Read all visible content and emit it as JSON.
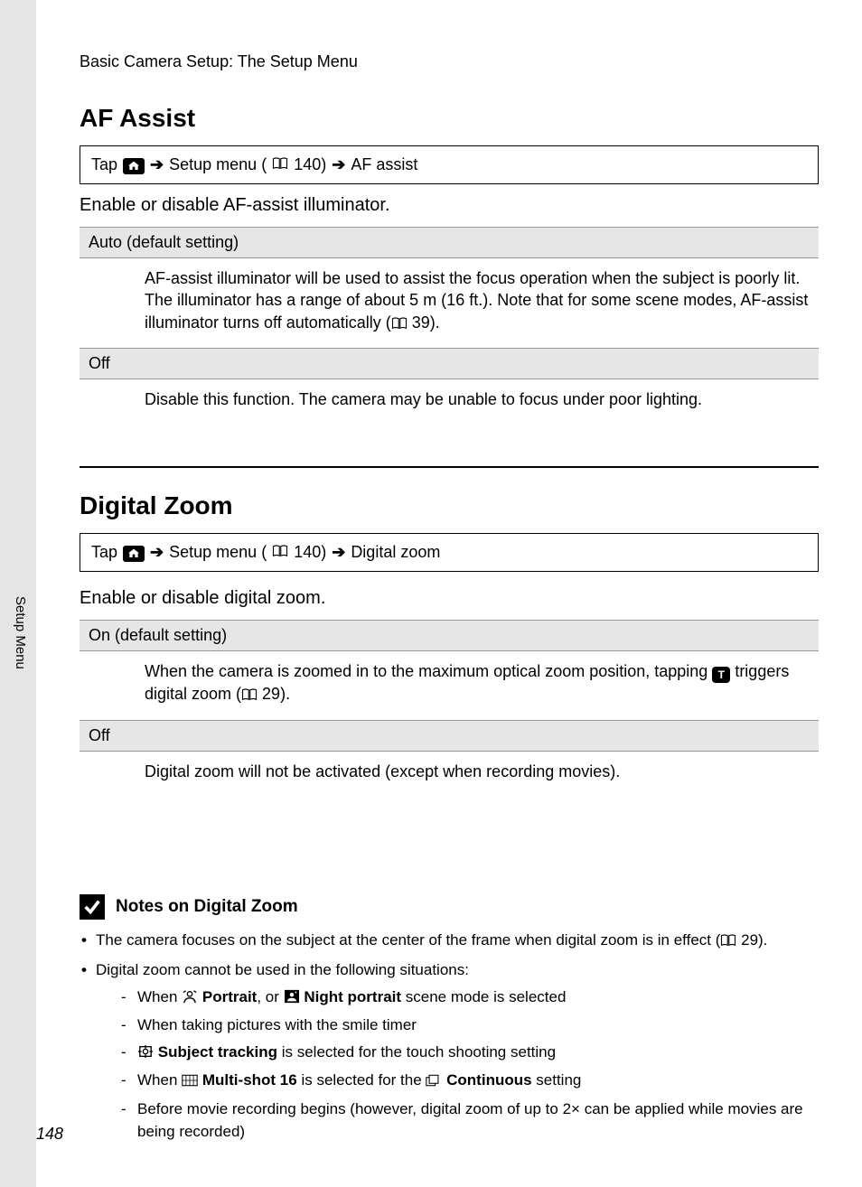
{
  "breadcrumb": "Basic Camera Setup: The Setup Menu",
  "side_tab": "Setup Menu",
  "page_number": "148",
  "sections": {
    "af": {
      "title": "AF Assist",
      "nav_tap": "Tap",
      "nav_setup": "Setup menu (",
      "nav_page": " 140) ",
      "nav_item": " AF assist",
      "intro": "Enable or disable AF-assist illuminator.",
      "opt1_title": "Auto (default setting)",
      "opt1_body_a": "AF-assist illuminator will be used to assist the focus operation when the subject is poorly lit. The illuminator has a range of about 5 m (16 ft.). Note that for some scene modes, AF-assist illuminator turns off automatically (",
      "opt1_body_b": " 39).",
      "opt2_title": "Off",
      "opt2_body": "Disable this function. The camera may be unable to focus under poor lighting."
    },
    "dz": {
      "title": "Digital Zoom",
      "nav_tap": "Tap",
      "nav_setup": "Setup menu (",
      "nav_page": " 140) ",
      "nav_item": " Digital zoom",
      "intro": "Enable or disable digital zoom.",
      "opt1_title": "On (default setting)",
      "opt1_body_a": "When the camera is zoomed in to the maximum optical zoom position, tapping ",
      "opt1_body_b": " triggers digital zoom (",
      "opt1_body_c": " 29).",
      "opt2_title": "Off",
      "opt2_body": "Digital zoom will not be activated (except when recording movies)."
    },
    "notes": {
      "title": "Notes on Digital Zoom",
      "n1a": "The camera focuses on the subject at the center of the frame when digital zoom is in effect (",
      "n1b": " 29).",
      "n2": "Digital zoom cannot be used in the following situations:",
      "s1a": "When ",
      "s1b": "Portrait",
      "s1c": ", or ",
      "s1d": "Night portrait",
      "s1e": " scene mode is selected",
      "s2": "When taking pictures with the smile timer",
      "s3a": "Subject tracking",
      "s3b": " is selected for the touch shooting setting",
      "s4a": "When ",
      "s4b": "Multi-shot 16",
      "s4c": " is selected for the ",
      "s4d": "Continuous",
      "s4e": " setting",
      "s5": "Before movie recording begins (however, digital zoom of up to 2× can be applied while movies are being recorded)"
    }
  },
  "t_label": "T"
}
